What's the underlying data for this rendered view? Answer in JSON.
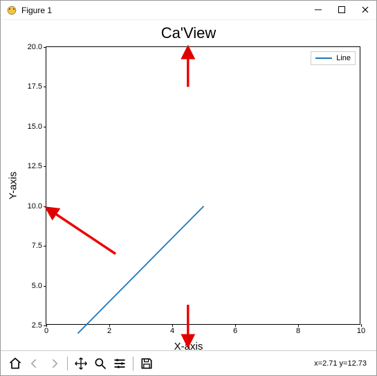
{
  "window": {
    "title": "Figure 1"
  },
  "chart_data": {
    "type": "line",
    "title": "Ca'View",
    "xlabel": "X-axis",
    "ylabel": "Y-axis",
    "xlim": [
      0,
      10
    ],
    "ylim": [
      2.5,
      20.0
    ],
    "x_ticks": [
      0,
      2,
      4,
      6,
      8,
      10
    ],
    "y_ticks": [
      2.5,
      5.0,
      7.5,
      10.0,
      12.5,
      15.0,
      17.5,
      20.0
    ],
    "series": [
      {
        "name": "Line",
        "x": [
          1,
          2,
          3,
          4,
          5
        ],
        "y": [
          2,
          4,
          6,
          8,
          10
        ]
      }
    ],
    "legend": {
      "position": "upper right",
      "entries": [
        "Line"
      ]
    },
    "annotations": [
      {
        "type": "arrow",
        "target": "title",
        "from": [
          4.5,
          17.5
        ],
        "to": [
          4.5,
          20.0
        ],
        "color": "#e00000"
      },
      {
        "type": "arrow",
        "target": "ylabel",
        "from": [
          2.2,
          7.0
        ],
        "to": [
          0.0,
          9.9
        ],
        "color": "#e00000"
      },
      {
        "type": "arrow",
        "target": "xlabel",
        "from": [
          4.5,
          3.8
        ],
        "to": [
          4.5,
          1.2
        ],
        "color": "#e00000"
      }
    ]
  },
  "toolbar": {
    "items": [
      "home",
      "back",
      "forward",
      "pan",
      "zoom",
      "configure",
      "save"
    ]
  },
  "status": {
    "coord_text": "x=2.71  y=12.73"
  }
}
